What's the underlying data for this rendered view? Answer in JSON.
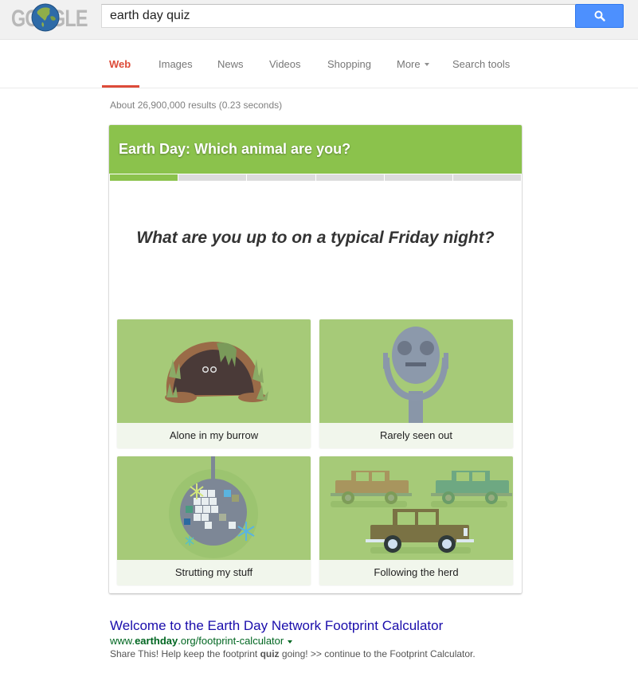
{
  "header": {
    "logo_text_left": "GO",
    "logo_text_right": "GLE",
    "search_query": "earth day quiz",
    "search_button_icon": "search-icon"
  },
  "tabs": [
    {
      "label": "Web",
      "active": true
    },
    {
      "label": "Images"
    },
    {
      "label": "News"
    },
    {
      "label": "Videos"
    },
    {
      "label": "Shopping"
    },
    {
      "label": "More"
    },
    {
      "label": "Search tools"
    }
  ],
  "stats": "About 26,900,000 results (0.23 seconds)",
  "quiz": {
    "title": "Earth Day: Which animal are you?",
    "progress": {
      "current_step": 1,
      "total_steps": 6
    },
    "question": "What are you up to on a typical Friday night?",
    "options": [
      {
        "label": "Alone in my burrow",
        "image": "burrow-illustration"
      },
      {
        "label": "Rarely seen out",
        "image": "binocular-viewer-illustration"
      },
      {
        "label": "Strutting my stuff",
        "image": "disco-ball-illustration"
      },
      {
        "label": "Following the herd",
        "image": "cars-illustration"
      }
    ],
    "colors": {
      "header": "#8bc24c",
      "tile": "#a6ca78",
      "label_bg": "#f1f6ec"
    }
  },
  "result": {
    "title": "Welcome to the Earth Day Network Footprint Calculator",
    "url_prefix": "www.",
    "url_bold": "earthday",
    "url_suffix": ".org/footprint-calculator",
    "snippet_before": "Share This! Help keep the footprint ",
    "snippet_bold": "quiz",
    "snippet_after": " going! >> continue to the Footprint Calculator."
  }
}
